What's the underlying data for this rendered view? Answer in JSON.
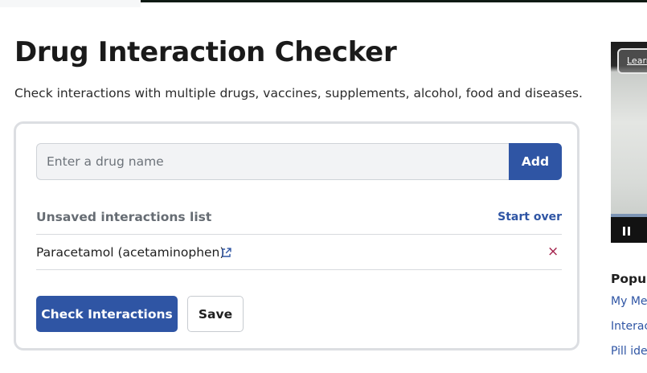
{
  "header": {
    "title": "Drug Interaction Checker",
    "subtitle": "Check interactions with multiple drugs, vaccines, supplements, alcohol, food and diseases."
  },
  "search": {
    "placeholder": "Enter a drug name",
    "value": "",
    "add_label": "Add"
  },
  "interaction_list": {
    "heading": "Unsaved interactions list",
    "start_over_label": "Start over",
    "items": [
      {
        "name": "Paracetamol (acetaminophen)",
        "remove_symbol": "×"
      }
    ]
  },
  "actions": {
    "check_label": "Check Interactions",
    "save_label": "Save"
  },
  "sidebar": {
    "ad_button_label": "Learn",
    "popular_heading": "Popula",
    "links": [
      "My Me",
      "Interac",
      "Pill ider"
    ]
  },
  "colors": {
    "primary": "#2f55a4",
    "remove": "#a3204a",
    "card_border": "#dcdee2"
  },
  "icons": [
    "external-link-icon",
    "remove-icon",
    "pause-icon"
  ]
}
